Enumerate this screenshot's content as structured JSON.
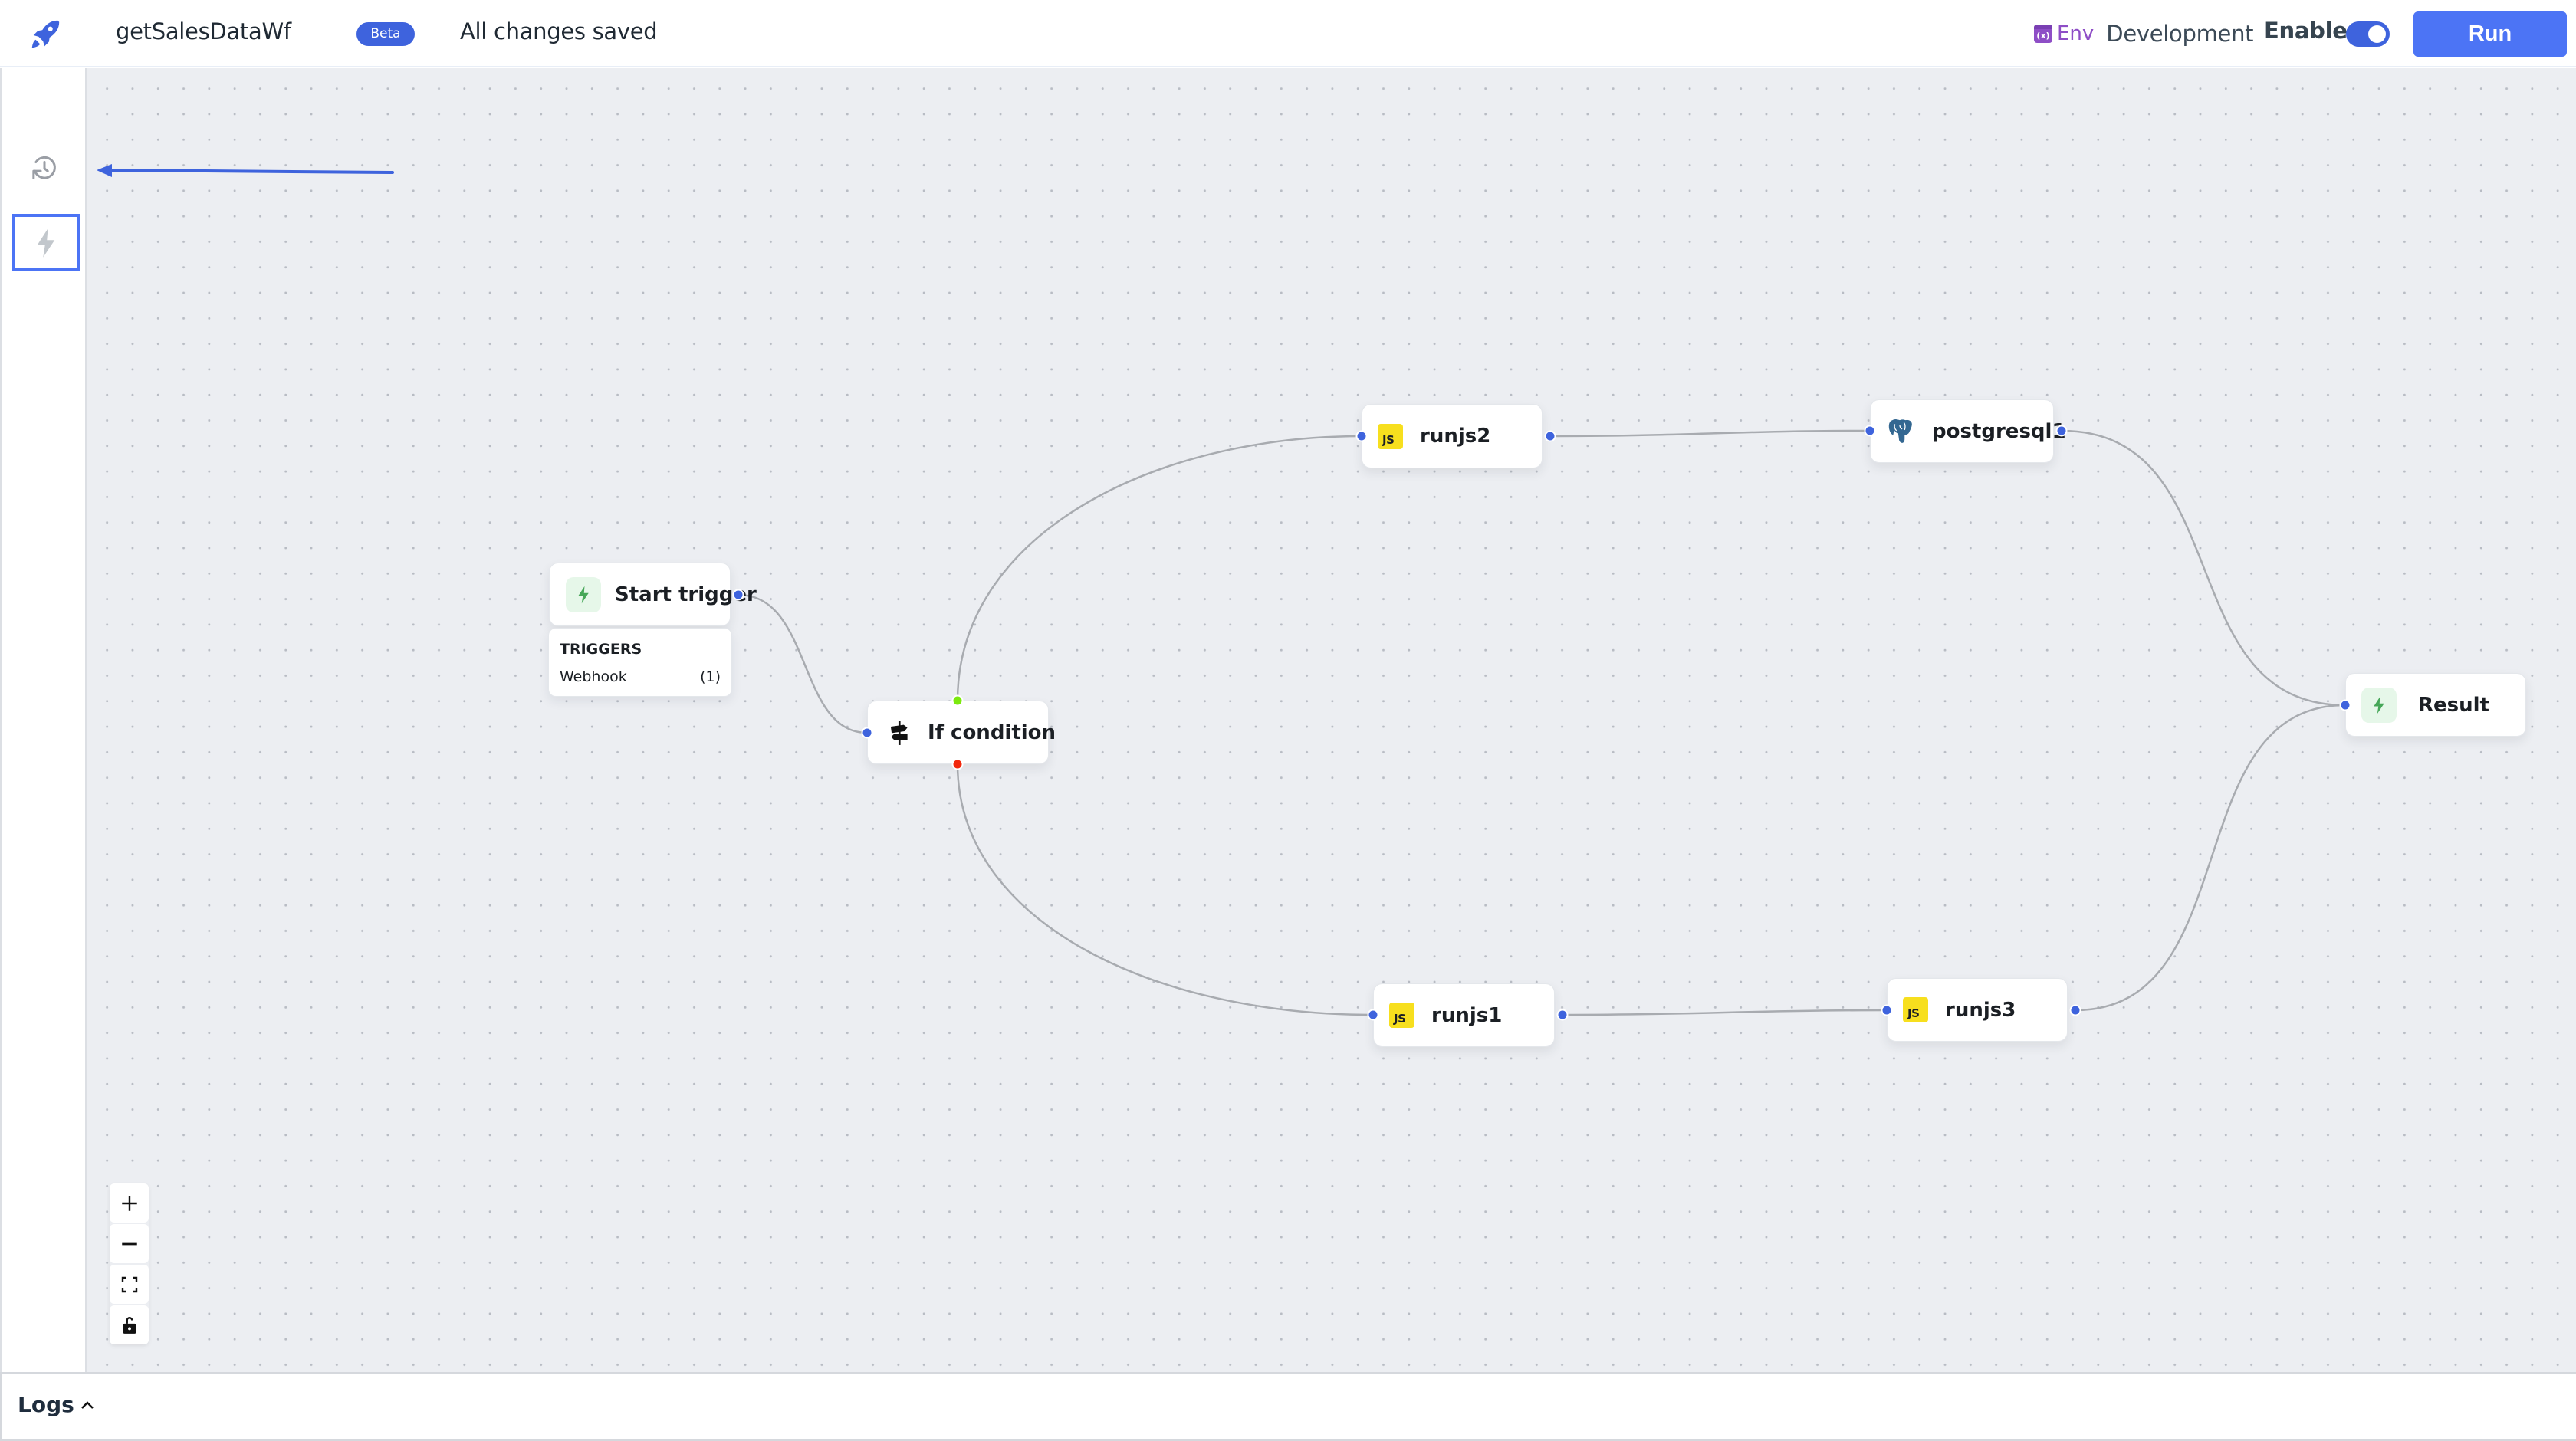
{
  "header": {
    "logo_icon": "rocket-icon",
    "workflow_name": "getSalesDataWf",
    "beta_badge": "Beta",
    "save_status": "All changes saved",
    "env_icon": "variable-icon",
    "env_label": "Env",
    "env_value": "Development",
    "enable_label": "Enable",
    "enabled": true,
    "run_label": "Run"
  },
  "rail": {
    "items": [
      {
        "icon": "history-icon",
        "active": false
      },
      {
        "icon": "lightning-icon",
        "active": true
      }
    ]
  },
  "annotation": {
    "type": "arrow",
    "points_to": "rail-trigger-button",
    "color": "#3e63dd"
  },
  "canvas": {
    "nodes": [
      {
        "id": "start",
        "label": "Start trigger",
        "icon": "lightning-icon"
      },
      {
        "id": "if",
        "label": "If condition",
        "icon": "signpost-icon"
      },
      {
        "id": "runjs2",
        "label": "runjs2",
        "icon": "javascript-icon"
      },
      {
        "id": "postgresql1",
        "label": "postgresql1",
        "icon": "postgresql-icon"
      },
      {
        "id": "runjs1",
        "label": "runjs1",
        "icon": "javascript-icon"
      },
      {
        "id": "runjs3",
        "label": "runjs3",
        "icon": "javascript-icon"
      },
      {
        "id": "result",
        "label": "Result",
        "icon": "lightning-icon"
      }
    ],
    "triggers": {
      "title": "TRIGGERS",
      "items": [
        {
          "name": "Webhook",
          "count": "(1)"
        }
      ]
    },
    "edges": [
      {
        "from": "start",
        "to": "if"
      },
      {
        "from": "if",
        "to": "runjs2",
        "branch": "true"
      },
      {
        "from": "if",
        "to": "runjs1",
        "branch": "false"
      },
      {
        "from": "runjs2",
        "to": "postgresql1"
      },
      {
        "from": "runjs1",
        "to": "runjs3"
      },
      {
        "from": "postgresql1",
        "to": "result"
      },
      {
        "from": "runjs3",
        "to": "result"
      }
    ],
    "js_badge": "JS"
  },
  "zoom_controls": [
    {
      "icon": "plus-icon"
    },
    {
      "icon": "minus-icon"
    },
    {
      "icon": "fit-view-icon"
    },
    {
      "icon": "lock-icon"
    }
  ],
  "logs": {
    "label": "Logs",
    "icon": "chevron-up-icon"
  }
}
